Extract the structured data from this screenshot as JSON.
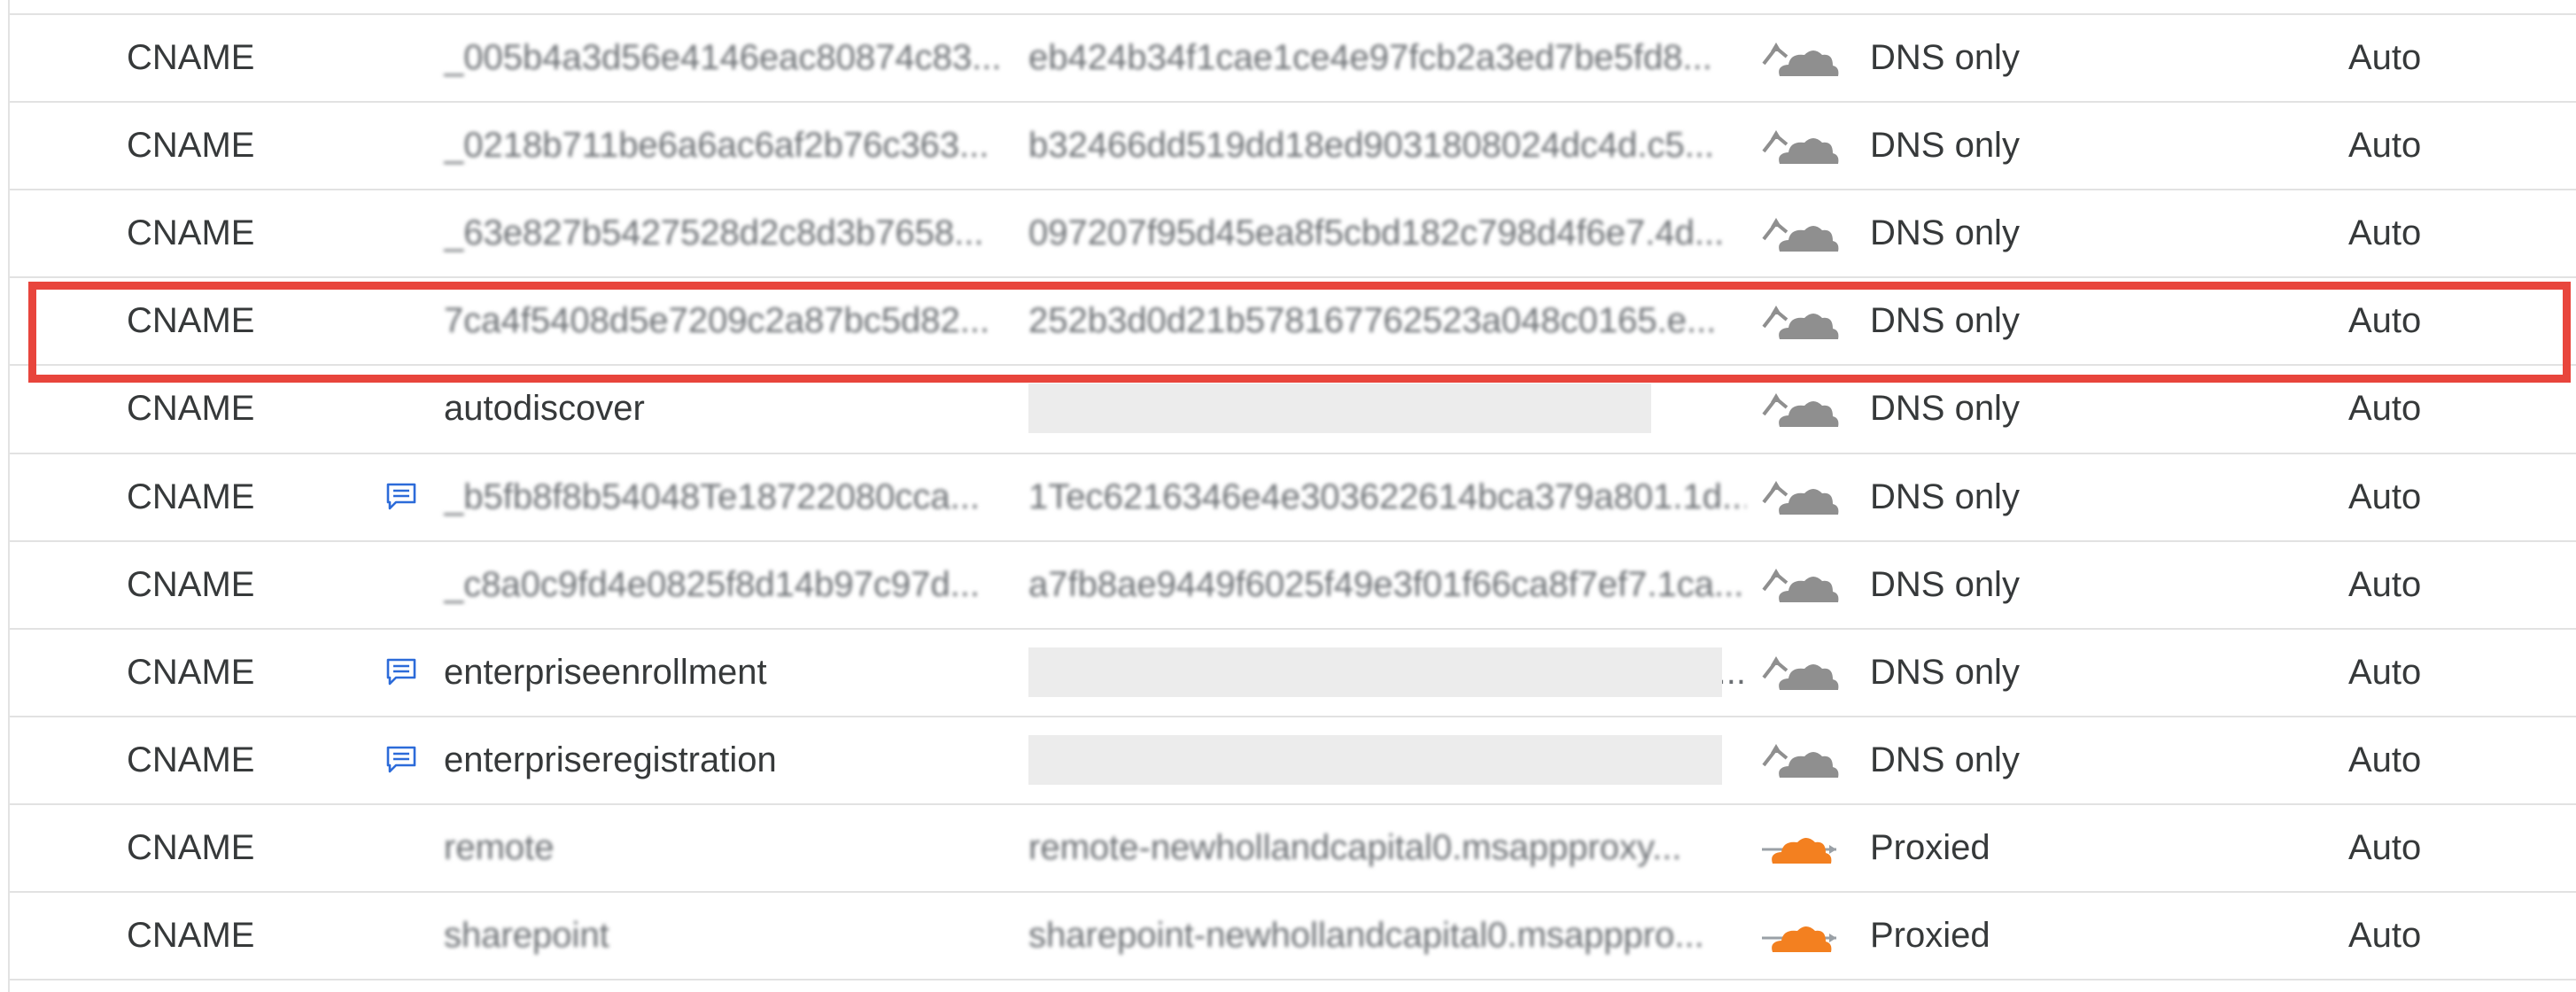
{
  "records": [
    {
      "type": "CNAME",
      "has_comment": false,
      "name": "_005b4a3d56e4146eac80874c83...",
      "name_blurred": true,
      "content": "eb424b34f1cae1ce4e97fcb2a3ed7be5fd8...",
      "content_blurred": true,
      "content_redacted": false,
      "proxy_status": "DNS only",
      "proxied": false,
      "ttl": "Auto"
    },
    {
      "type": "CNAME",
      "has_comment": false,
      "name": "_0218b711be6a6ac6af2b76c363...",
      "name_blurred": true,
      "content": "b32466dd519dd18ed9031808024dc4d.c5...",
      "content_blurred": true,
      "content_redacted": false,
      "proxy_status": "DNS only",
      "proxied": false,
      "ttl": "Auto"
    },
    {
      "type": "CNAME",
      "has_comment": false,
      "name": "_63e827b5427528d2c8d3b7658...",
      "name_blurred": true,
      "content": "097207f95d45ea8f5cbd182c798d4f6e7.4d...",
      "content_blurred": true,
      "content_redacted": false,
      "proxy_status": "DNS only",
      "proxied": false,
      "ttl": "Auto"
    },
    {
      "type": "CNAME",
      "has_comment": false,
      "name": "7ca4f5408d5e7209c2a87bc5d82...",
      "name_blurred": true,
      "content": "252b3d0d21b578167762523a048c0165.e...",
      "content_blurred": true,
      "content_redacted": false,
      "proxy_status": "DNS only",
      "proxied": false,
      "ttl": "Auto",
      "highlighted": true
    },
    {
      "type": "CNAME",
      "has_comment": false,
      "name": "autodiscover",
      "name_blurred": false,
      "content": "",
      "content_blurred": false,
      "content_redacted": true,
      "proxy_status": "DNS only",
      "proxied": false,
      "ttl": "Auto"
    },
    {
      "type": "CNAME",
      "has_comment": true,
      "name": "_b5fb8f8b54048Te18722080cca...",
      "name_blurred": true,
      "content": "1Tec6216346e4e303622614bca379a801.1d...",
      "content_blurred": true,
      "content_redacted": false,
      "proxy_status": "DNS only",
      "proxied": false,
      "ttl": "Auto"
    },
    {
      "type": "CNAME",
      "has_comment": false,
      "name": "_c8a0c9fd4e0825f8d14b97c97d...",
      "name_blurred": true,
      "content": "a7fb8ae9449f6025f49e3f01f66ca8f7ef7.1ca...",
      "content_blurred": true,
      "content_redacted": false,
      "proxy_status": "DNS only",
      "proxied": false,
      "ttl": "Auto"
    },
    {
      "type": "CNAME",
      "has_comment": true,
      "name": "enterpriseenrollment",
      "name_blurred": false,
      "content": "...",
      "content_blurred": false,
      "content_redacted": true,
      "proxy_status": "DNS only",
      "proxied": false,
      "ttl": "Auto"
    },
    {
      "type": "CNAME",
      "has_comment": true,
      "name": "enterpriseregistration",
      "name_blurred": false,
      "content": "",
      "content_blurred": false,
      "content_redacted": true,
      "proxy_status": "DNS only",
      "proxied": false,
      "ttl": "Auto"
    },
    {
      "type": "CNAME",
      "has_comment": false,
      "name": "remote",
      "name_blurred": true,
      "content": "remote-newhollandcapital0.msappproxy...",
      "content_blurred": true,
      "content_redacted": false,
      "proxy_status": "Proxied",
      "proxied": true,
      "ttl": "Auto"
    },
    {
      "type": "CNAME",
      "has_comment": false,
      "name": "sharepoint",
      "name_blurred": true,
      "content": "sharepoint-newhollandcapital0.msapppro...",
      "content_blurred": true,
      "content_redacted": false,
      "proxy_status": "Proxied",
      "proxied": true,
      "ttl": "Auto"
    }
  ],
  "colors": {
    "dns_only_cloud": "#8f8f8f",
    "proxied_cloud": "#f38020",
    "comment_icon": "#2c6bd9",
    "highlight_border": "#e8453c"
  },
  "icons": {
    "dns_only": "cloud-dns-only-icon",
    "proxied": "cloud-proxied-icon",
    "comment": "comment-icon"
  }
}
